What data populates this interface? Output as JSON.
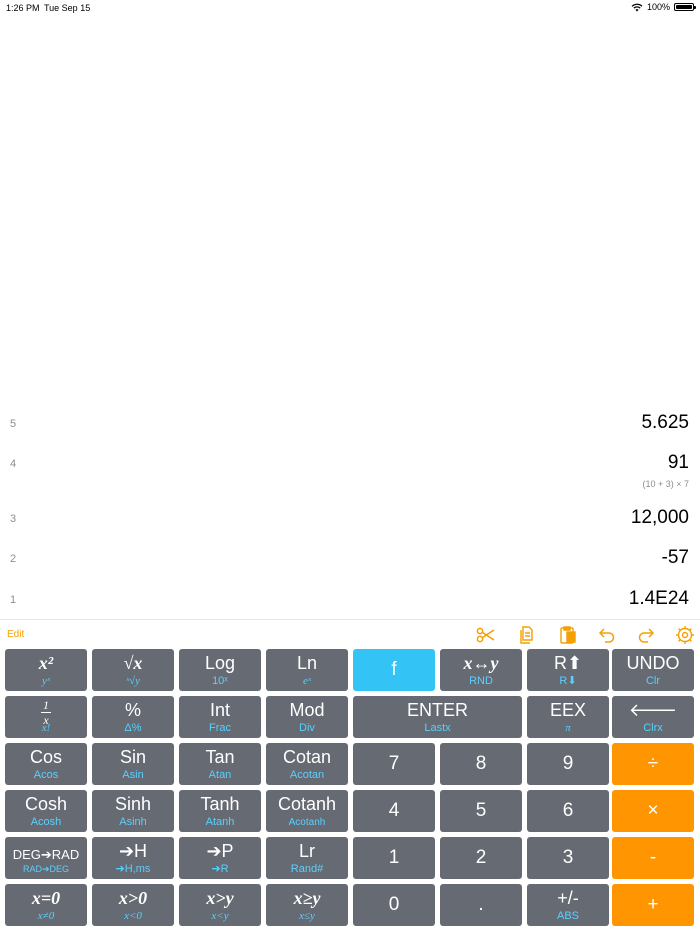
{
  "status": {
    "time": "1:26 PM",
    "date": "Tue Sep 15",
    "battery": "100%"
  },
  "stack": [
    {
      "index": "5",
      "value": "5.625",
      "expr": ""
    },
    {
      "index": "4",
      "value": "91",
      "expr": "(10 + 3) × 7"
    },
    {
      "index": "3",
      "value": "12,000",
      "expr": ""
    },
    {
      "index": "2",
      "value": "-57",
      "expr": ""
    },
    {
      "index": "1",
      "value": "1.4E24",
      "expr": ""
    }
  ],
  "toolbar": {
    "edit": "Edit",
    "icons": [
      "scissors-icon",
      "copy-icon",
      "paste-icon",
      "undo-arrow-icon",
      "redo-arrow-icon",
      "settings-icon"
    ]
  },
  "colors": {
    "accent": "#f5a000",
    "key": "#666a73",
    "key_f": "#33c3f5",
    "key_op": "#ff9500",
    "shift_text": "#5ad0ff"
  },
  "keys": {
    "r1": [
      {
        "main": "x²",
        "sub": "yˣ"
      },
      {
        "main": "√x",
        "sub": "ˣ√y"
      },
      {
        "main": "Log",
        "sub": "10ˣ"
      },
      {
        "main": "Ln",
        "sub": "eˣ"
      },
      {
        "main": "f"
      },
      {
        "main": "x↔y",
        "sub": "RND"
      },
      {
        "main": "R⬆",
        "sub": "R⬇"
      },
      {
        "main": "UNDO",
        "sub": "Clr"
      }
    ],
    "r2": [
      {
        "num": "1",
        "den": "x",
        "sub": "x!"
      },
      {
        "main": "%",
        "sub": "Δ%"
      },
      {
        "main": "Int",
        "sub": "Frac"
      },
      {
        "main": "Mod",
        "sub": "Div"
      },
      {
        "main": "ENTER",
        "sub": "Lastx"
      },
      {
        "main": "EEX",
        "sub": "π"
      },
      {
        "main": "🡐",
        "sub": "Clrx"
      }
    ],
    "r3": [
      {
        "main": "Cos",
        "sub": "Acos"
      },
      {
        "main": "Sin",
        "sub": "Asin"
      },
      {
        "main": "Tan",
        "sub": "Atan"
      },
      {
        "main": "Cotan",
        "sub": "Acotan"
      },
      {
        "main": "7"
      },
      {
        "main": "8"
      },
      {
        "main": "9"
      },
      {
        "main": "÷"
      }
    ],
    "r4": [
      {
        "main": "Cosh",
        "sub": "Acosh"
      },
      {
        "main": "Sinh",
        "sub": "Asinh"
      },
      {
        "main": "Tanh",
        "sub": "Atanh"
      },
      {
        "main": "Cotanh",
        "sub": "Acotanh"
      },
      {
        "main": "4"
      },
      {
        "main": "5"
      },
      {
        "main": "6"
      },
      {
        "main": "×"
      }
    ],
    "r5": [
      {
        "main": "DEG➔RAD",
        "sub": "RAD➔DEG"
      },
      {
        "main": "➔H",
        "sub": "➔H,ms"
      },
      {
        "main": "➔P",
        "sub": "➔R"
      },
      {
        "main": "Lr",
        "sub": "Rand#"
      },
      {
        "main": "1"
      },
      {
        "main": "2"
      },
      {
        "main": "3"
      },
      {
        "main": "-"
      }
    ],
    "r6": [
      {
        "main": "x=0",
        "sub": "x≠0"
      },
      {
        "main": "x>0",
        "sub": "x<0"
      },
      {
        "main": "x>y",
        "sub": "x<y"
      },
      {
        "main": "x≥y",
        "sub": "x≤y"
      },
      {
        "main": "0"
      },
      {
        "main": "."
      },
      {
        "main": "+/-",
        "sub": "ABS"
      },
      {
        "main": "+"
      }
    ]
  }
}
